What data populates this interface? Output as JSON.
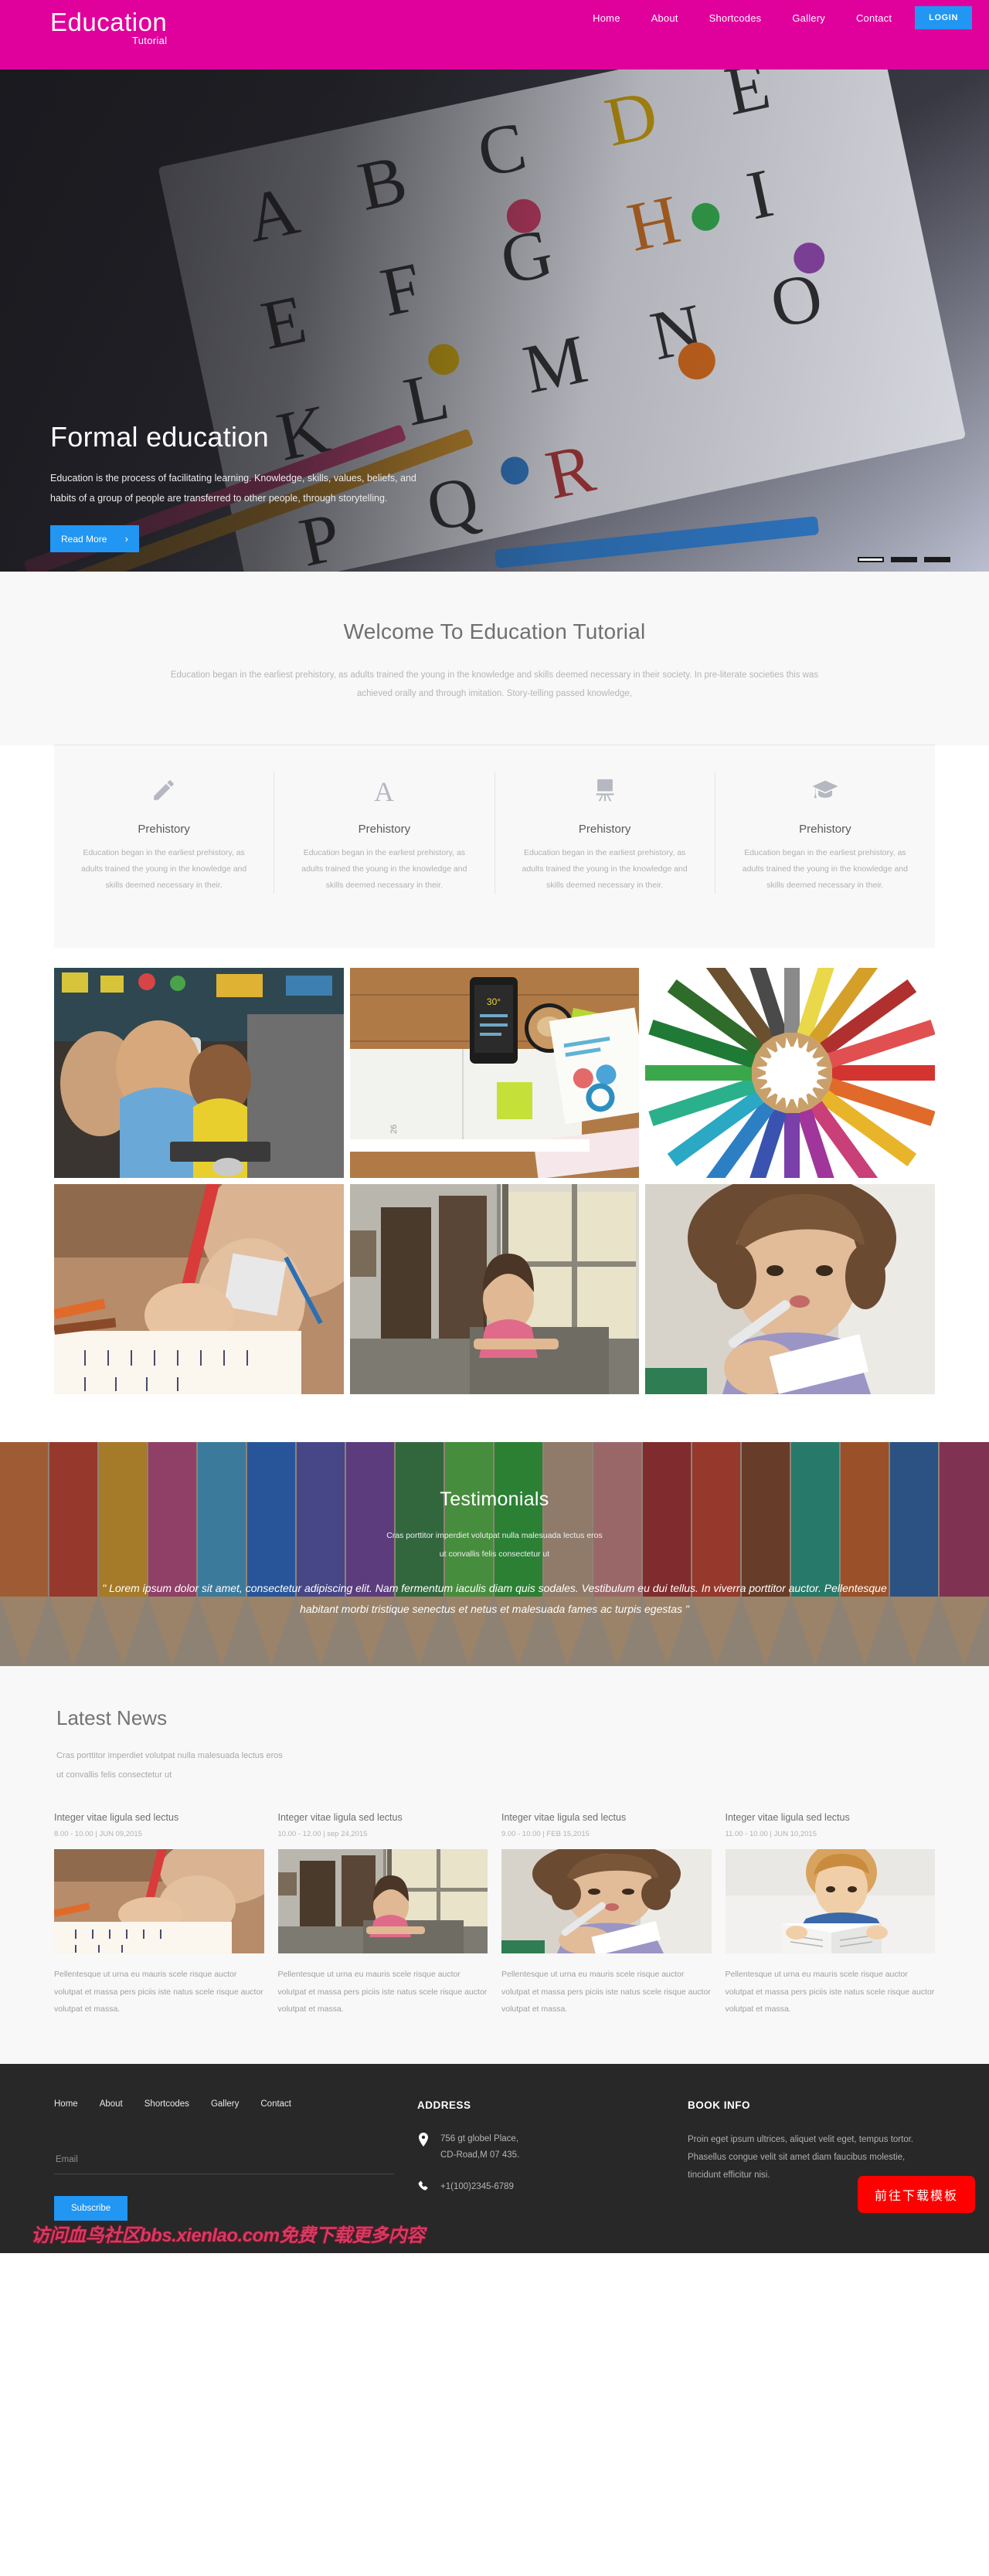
{
  "brand": {
    "name": "Education",
    "tagline": "Tutorial",
    "pink": "#e0009b",
    "blue": "#2196f3"
  },
  "nav": {
    "items": [
      "Home",
      "About",
      "Shortcodes",
      "Gallery",
      "Contact"
    ],
    "login_label": "LOGIN"
  },
  "hero": {
    "title": "Formal education",
    "description": "Education is the process of facilitating learning. Knowledge, skills, values, beliefs, and habits of a group of people are transferred to other people, through storytelling.",
    "button_label": "Read More",
    "chevron": "›",
    "slide_count": 3,
    "active_slide": 1
  },
  "welcome": {
    "title": "Welcome To Education Tutorial",
    "subtitle": "Education began in the earliest prehistory, as adults trained the young in the knowledge and skills deemed necessary in their society. In pre-literate societies this was achieved orally and through imitation. Story-telling passed knowledge,"
  },
  "features": [
    {
      "icon": "pencil-icon",
      "title": "Prehistory",
      "desc": "Education began in the earliest prehistory, as adults trained the young in the knowledge and skills deemed necessary in their."
    },
    {
      "icon": "letter-a-icon",
      "title": "Prehistory",
      "desc": "Education began in the earliest prehistory, as adults trained the young in the knowledge and skills deemed necessary in their."
    },
    {
      "icon": "easel-icon",
      "title": "Prehistory",
      "desc": "Education began in the earliest prehistory, as adults trained the young in the knowledge and skills deemed necessary in their."
    },
    {
      "icon": "graduation-cap-icon",
      "title": "Prehistory",
      "desc": "Education began in the earliest prehistory, as adults trained the young in the knowledge and skills deemed necessary in their."
    }
  ],
  "gallery": {
    "items": [
      "kids-at-computers",
      "desk-with-phone-and-coffee",
      "colored-pencils-circle",
      "child-writing-with-red-pencil",
      "girl-at-desk-by-window",
      "girl-writing-with-chalk"
    ]
  },
  "testimonials": {
    "title": "Testimonials",
    "subtitle_line1": "Cras porttitor imperdiet volutpat nulla malesuada lectus eros",
    "subtitle_line2": "ut convallis felis consectetur ut",
    "quote": "\" Lorem ipsum dolor sit amet, consectetur adipiscing elit. Nam fermentum iaculis diam quis sodales. Vestibulum eu dui tellus. In viverra porttitor auctor. Pellentesque habitant morbi tristique senectus et netus et malesuada fames ac turpis egestas \""
  },
  "news": {
    "title": "Latest News",
    "subtitle_line1": "Cras porttitor imperdiet volutpat nulla malesuada lectus eros",
    "subtitle_line2": "ut convallis felis consectetur ut",
    "items": [
      {
        "heading": "Integer vitae ligula sed lectus",
        "meta": "8.00 - 10.00 | JUN 09,2015",
        "image": "child-writing-with-red-pencil",
        "desc": "Pellentesque ut urna eu mauris scele risque auctor volutpat et massa pers piciis iste natus scele risque auctor volutpat et massa."
      },
      {
        "heading": "Integer vitae ligula sed lectus",
        "meta": "10.00 - 12.00 | sep 24,2015",
        "image": "girl-at-desk-by-window",
        "desc": "Pellentesque ut urna eu mauris scele risque auctor volutpat et massa pers piciis iste natus scele risque auctor volutpat et massa."
      },
      {
        "heading": "Integer vitae ligula sed lectus",
        "meta": "9.00 - 10.00 | FEB 15,2015",
        "image": "girl-writing-with-chalk",
        "desc": "Pellentesque ut urna eu mauris scele risque auctor volutpat et massa pers piciis iste natus scele risque auctor volutpat et massa."
      },
      {
        "heading": "Integer vitae ligula sed lectus",
        "meta": "11.00 - 10.00 | JUN 10,2015",
        "image": "boy-reading-book",
        "desc": "Pellentesque ut urna eu mauris scele risque auctor volutpat et massa pers piciis iste natus scele risque auctor volutpat et massa."
      }
    ]
  },
  "footer": {
    "nav_items": [
      "Home",
      "About",
      "Shortcodes",
      "Gallery",
      "Contact"
    ],
    "email_placeholder": "Email",
    "email_value": "",
    "subscribe_label": "Subscribe",
    "address_heading": "ADDRESS",
    "address_line1": "756 gt globel Place,",
    "address_line2": "CD-Road,M 07 435.",
    "phone": "+1(100)2345-6789",
    "book_heading": "BOOK INFO",
    "book_text": "Proin eget ipsum ultrices, aliquet velit eget, tempus tortor. Phasellus congue velit sit amet diam faucibus molestie, tincidunt efficitur nisi."
  },
  "overlay": {
    "download_button": "前往下载模板",
    "watermark": "访问血鸟社区bbs.xienlao.com免费下载更多内容"
  }
}
